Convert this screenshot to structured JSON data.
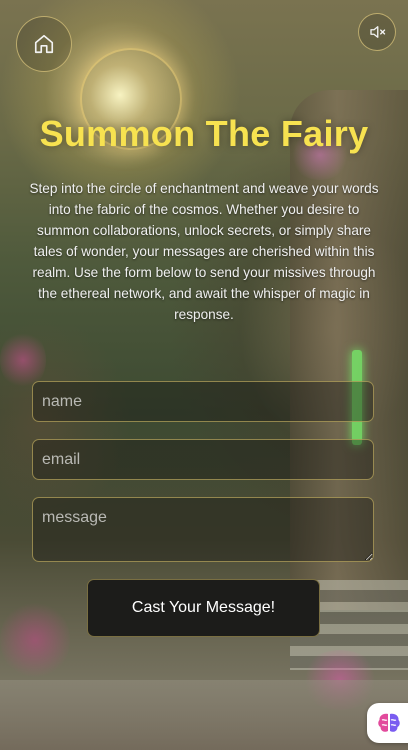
{
  "header": {
    "home_icon": "home-icon",
    "sound_icon": "speaker-muted-icon"
  },
  "hero": {
    "title": "Summon The Fairy",
    "intro": "Step into the circle of enchantment and weave your words into the fabric of the cosmos. Whether you desire to summon collaborations, unlock secrets, or simply share tales of wonder, your messages are cherished within this realm. Use the form below to send your missives through the ethereal network, and await the whisper of magic in response."
  },
  "form": {
    "name": {
      "value": "",
      "placeholder": "name"
    },
    "email": {
      "value": "",
      "placeholder": "email"
    },
    "message": {
      "value": "",
      "placeholder": "message"
    },
    "submit_label": "Cast Your Message!"
  },
  "widget": {
    "icon": "brain-icon"
  },
  "colors": {
    "title": "#f7e250",
    "accent_border": "#c8b464",
    "button_bg": "#1c1c1a",
    "brain_pink": "#e24a9c",
    "brain_purple": "#7a5cf0"
  }
}
